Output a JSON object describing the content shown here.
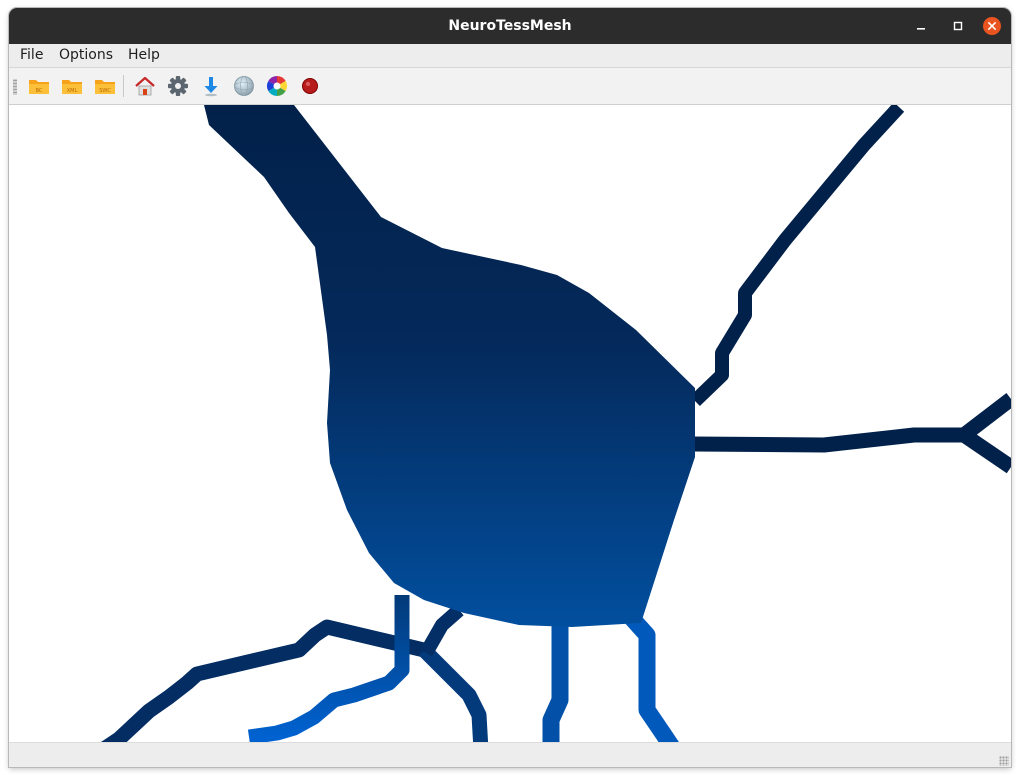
{
  "window": {
    "title": "NeuroTessMesh",
    "close_color": "#e95420",
    "titlebar_color": "#2c2c2c"
  },
  "menu": {
    "items": [
      {
        "label": "File"
      },
      {
        "label": "Options"
      },
      {
        "label": "Help"
      }
    ]
  },
  "toolbar": {
    "buttons": [
      {
        "name": "open-bc",
        "icon": "folder-icon",
        "tag": "BC"
      },
      {
        "name": "open-xml",
        "icon": "folder-icon",
        "tag": "XML"
      },
      {
        "name": "open-swc",
        "icon": "folder-icon",
        "tag": "SWC"
      },
      {
        "name": "home",
        "icon": "home-icon"
      },
      {
        "name": "settings",
        "icon": "gear-icon"
      },
      {
        "name": "download",
        "icon": "down-arrow-icon"
      },
      {
        "name": "sphere",
        "icon": "sphere-icon"
      },
      {
        "name": "color-wheel",
        "icon": "color-wheel-icon"
      },
      {
        "name": "record",
        "icon": "record-icon"
      }
    ]
  },
  "viewport": {
    "content": "3D neuron mesh render",
    "colors": {
      "dark": "#02214a",
      "light": "#0062d0"
    }
  }
}
